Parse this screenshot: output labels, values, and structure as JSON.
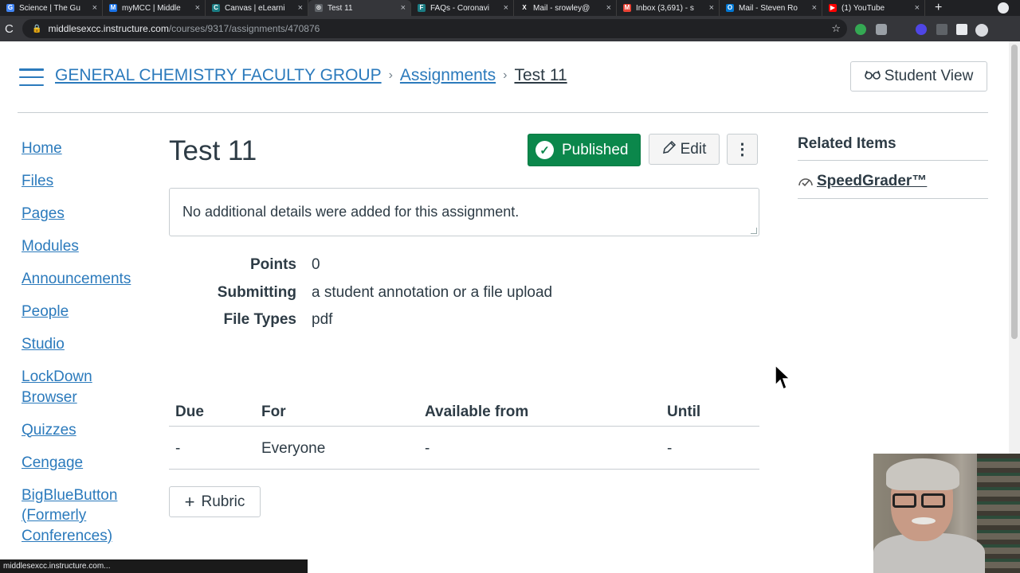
{
  "browser": {
    "tabs": [
      {
        "label": "Science | The Gu",
        "favicon": "G",
        "color": "#4285f4"
      },
      {
        "label": "myMCC | Middle",
        "favicon": "M",
        "color": "#1a73e8"
      },
      {
        "label": "Canvas | eLearni",
        "favicon": "C",
        "color": "#1b7c83"
      },
      {
        "label": "Test 11",
        "favicon": "⊙",
        "color": "#5f6368",
        "active": true
      },
      {
        "label": "FAQs - Coronavi",
        "favicon": "F",
        "color": "#1b7c83"
      },
      {
        "label": "Mail - srowley@",
        "favicon": "X",
        "color": "#202124"
      },
      {
        "label": "Inbox (3,691) - s",
        "favicon": "M",
        "color": "#ea4335"
      },
      {
        "label": "Mail - Steven Ro",
        "favicon": "O",
        "color": "#0078d4"
      },
      {
        "label": "(1) YouTube",
        "favicon": "▶",
        "color": "#ff0000"
      }
    ],
    "close_glyph": "×",
    "new_tab_glyph": "+",
    "reload_glyph": "C",
    "url_host": "middlesexcc.instructure.com",
    "url_path": "/courses/9317/assignments/470876",
    "status_url": "middlesexcc.instructure.com..."
  },
  "header": {
    "breadcrumbs": [
      "GENERAL CHEMISTRY FACULTY GROUP",
      "Assignments",
      "Test 11"
    ],
    "crumb_sep": "›",
    "student_view_label": "Student View",
    "student_view_icon": "glasses-icon"
  },
  "nav": {
    "items": [
      "Home",
      "Files",
      "Pages",
      "Modules",
      "Announcements",
      "People",
      "Studio",
      "LockDown Browser",
      "Quizzes",
      "Cengage",
      "BigBlueButton (Formerly Conferences)"
    ]
  },
  "assignment": {
    "title": "Test 11",
    "published_label": "Published",
    "edit_label": "Edit",
    "kebab_glyph": "⋮",
    "description": "No additional details were added for this assignment.",
    "details": [
      {
        "label": "Points",
        "value": "0"
      },
      {
        "label": "Submitting",
        "value": "a student annotation or a file upload"
      },
      {
        "label": "File Types",
        "value": "pdf"
      }
    ],
    "dates": {
      "headers": [
        "Due",
        "For",
        "Available from",
        "Until"
      ],
      "row": [
        "-",
        "Everyone",
        "-",
        "-"
      ]
    },
    "rubric_label": "Rubric"
  },
  "related": {
    "title": "Related Items",
    "items": [
      "SpeedGrader™"
    ]
  },
  "colors": {
    "link": "#2b7abc",
    "published_green": "#0b874b",
    "text": "#2d3b45"
  }
}
